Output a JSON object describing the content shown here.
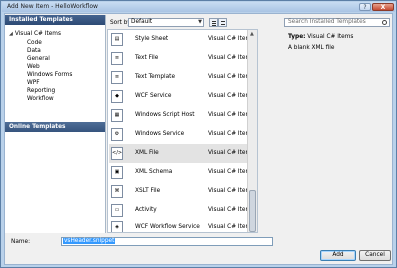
{
  "window": {
    "title": "Add New Item - HelloWorkflow",
    "help_glyph": "?",
    "close_glyph": "X"
  },
  "left_pane": {
    "installed_header": "Installed Templates",
    "tree_root": "Visual C# Items",
    "tree_items": [
      "Code",
      "Data",
      "General",
      "Web",
      "Windows Forms",
      "WPF",
      "Reporting",
      "Workflow"
    ],
    "online_header": "Online Templates"
  },
  "toolbar": {
    "sort_label": "Sort by:",
    "sort_value": "Default"
  },
  "search": {
    "placeholder": "Search Installed Templates"
  },
  "templates": [
    {
      "name": "Style Sheet",
      "category": "Visual C# Items",
      "icon": "css-file-icon"
    },
    {
      "name": "Text File",
      "category": "Visual C# Items",
      "icon": "text-file-icon"
    },
    {
      "name": "Text Template",
      "category": "Visual C# Items",
      "icon": "text-template-icon"
    },
    {
      "name": "WCF Service",
      "category": "Visual C# Items",
      "icon": "wcf-service-icon"
    },
    {
      "name": "Windows Script Host",
      "category": "Visual C# Items",
      "icon": "script-host-icon"
    },
    {
      "name": "Windows Service",
      "category": "Visual C# Items",
      "icon": "windows-service-icon"
    },
    {
      "name": "XML File",
      "category": "Visual C# Items",
      "icon": "xml-file-icon",
      "selected": true
    },
    {
      "name": "XML Schema",
      "category": "Visual C# Items",
      "icon": "xml-schema-icon"
    },
    {
      "name": "XSLT File",
      "category": "Visual C# Items",
      "icon": "xslt-file-icon"
    },
    {
      "name": "Activity",
      "category": "Visual C# Items",
      "icon": "activity-icon"
    },
    {
      "name": "WCF Workflow Service",
      "category": "Visual C# Items",
      "icon": "wcf-workflow-icon"
    }
  ],
  "details": {
    "type_label": "Type:",
    "type_value": "Visual C# Items",
    "description": "A blank XML file"
  },
  "name_field": {
    "label": "Name:",
    "value": "vsHeader.snippet"
  },
  "buttons": {
    "add": "Add",
    "cancel": "Cancel"
  }
}
